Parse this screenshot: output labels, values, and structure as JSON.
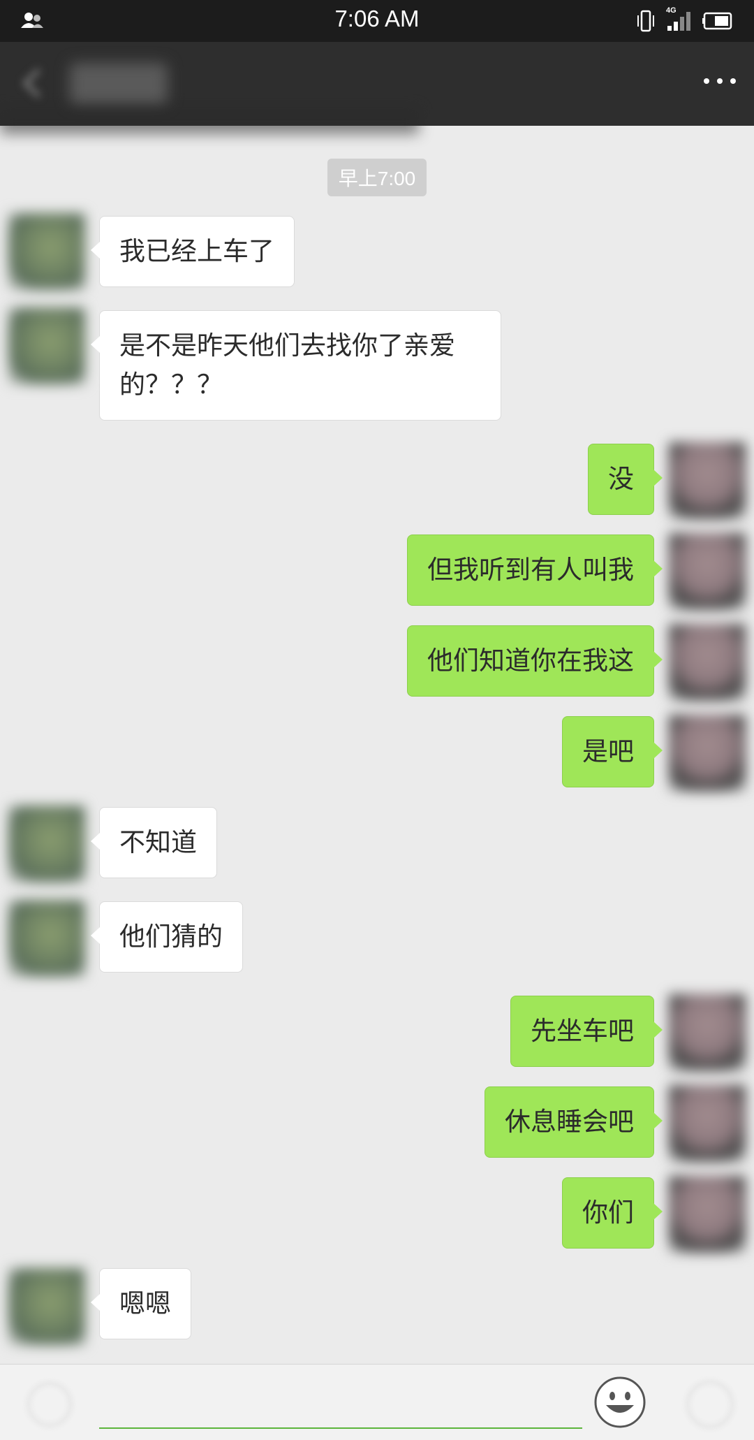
{
  "status_bar": {
    "time": "7:06 AM",
    "network": "4G",
    "icons": [
      "contacts-icon",
      "vibrate-icon",
      "signal-icon",
      "battery-icon"
    ]
  },
  "header": {
    "title": "",
    "icons": [
      "back-arrow-icon",
      "more-icon"
    ]
  },
  "chat": {
    "timestamp": "早上7:00",
    "messages": [
      {
        "side": "in",
        "text": "我已经上车了"
      },
      {
        "side": "in",
        "text": "是不是昨天他们去找你了亲爱的？？？"
      },
      {
        "side": "out",
        "text": "没"
      },
      {
        "side": "out",
        "text": "但我听到有人叫我"
      },
      {
        "side": "out",
        "text": "他们知道你在我这"
      },
      {
        "side": "out",
        "text": "是吧"
      },
      {
        "side": "in",
        "text": "不知道"
      },
      {
        "side": "in",
        "text": "他们猜的"
      },
      {
        "side": "out",
        "text": "先坐车吧"
      },
      {
        "side": "out",
        "text": "休息睡会吧"
      },
      {
        "side": "out",
        "text": "你们"
      },
      {
        "side": "in",
        "text": "嗯嗯"
      }
    ]
  },
  "input_bar": {
    "value": "",
    "icons": [
      "voice-icon",
      "emoji-icon",
      "plus-icon"
    ]
  },
  "colors": {
    "status_bar": "#1c1c1c",
    "title_bar": "#2e2e2e",
    "chat_background": "#ebebeb",
    "incoming_bubble": "#ffffff",
    "outgoing_bubble": "#9fe658",
    "input_underline": "#5cb53c"
  }
}
